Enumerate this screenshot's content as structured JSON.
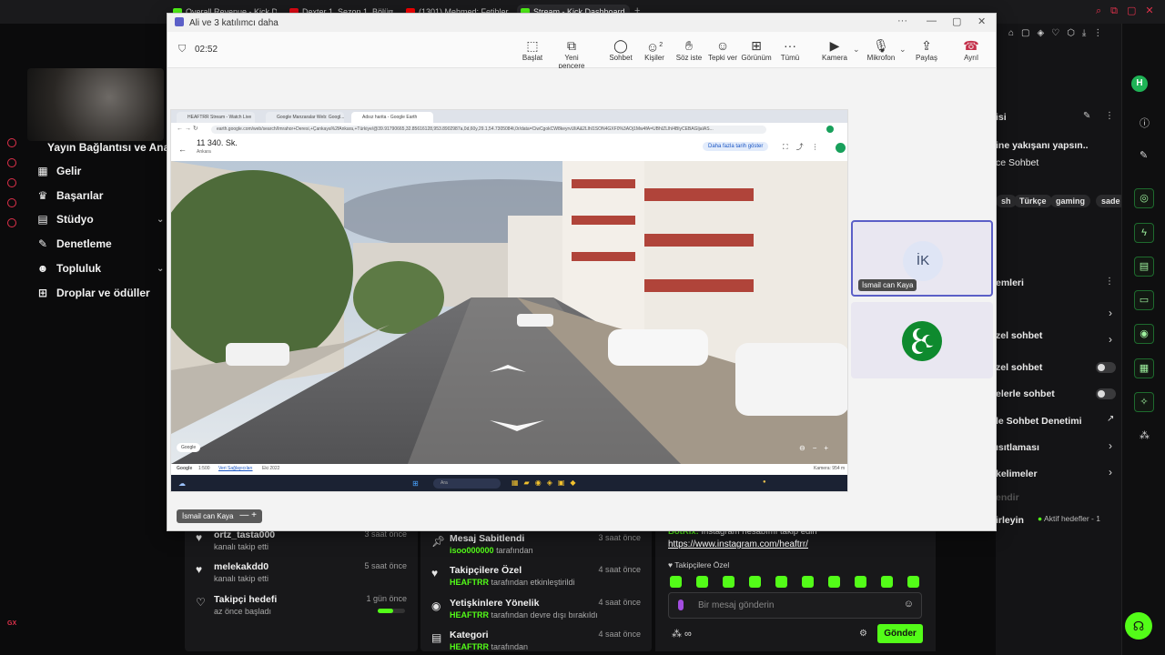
{
  "browser_tabs": [
    {
      "label": "Overall Revenue - Kick Da"
    },
    {
      "label": "Dexter 1. Sezon 1. Bölüm"
    },
    {
      "label": "(1301) Mehmed: Fetihler S"
    },
    {
      "label": "Stream - Kick Dashboard"
    }
  ],
  "sidebar": {
    "header": "Yayın Bağlantısı ve Anahta",
    "items": [
      {
        "label": "Gelir"
      },
      {
        "label": "Başarılar"
      },
      {
        "label": "Stüdyo"
      },
      {
        "label": "Denetleme"
      },
      {
        "label": "Topluluk"
      },
      {
        "label": "Droplar ve ödüller"
      }
    ]
  },
  "teams": {
    "window_title": "Ali ve 3 katılımcı daha",
    "timer": "02:52",
    "toolbar": [
      {
        "label": "Başlat"
      },
      {
        "label": "Yeni pencere"
      },
      {
        "label": "Sohbet"
      },
      {
        "label": "Kişiler",
        "count": "2"
      },
      {
        "label": "Söz iste"
      },
      {
        "label": "Tepki ver"
      },
      {
        "label": "Görünüm"
      },
      {
        "label": "Tümü"
      },
      {
        "label": "Kamera"
      },
      {
        "label": "Mikrofon"
      },
      {
        "label": "Paylaş"
      },
      {
        "label": "Ayrıl"
      }
    ],
    "presenter_tag": "İsmail can Kaya",
    "participants": [
      {
        "initials": "İK",
        "name": "İsmail can Kaya"
      },
      {
        "initials": "",
        "name": ""
      }
    ]
  },
  "shared_screen": {
    "tabs": [
      {
        "label": "HEAFTRR Stream - Watch Live"
      },
      {
        "label": "Google Manzaralar Web: Googl..."
      },
      {
        "label": "Adsız harita - Google Earth"
      }
    ],
    "url": "earth.google.com/web/search/Imrahor+Deresi,+Çankaya%2fAnkara,+Türkiye/@39.91790665,32.85616128,953.8902987a,0d,60y,29.1,54.7305084t,0r/data=CiwCgokCW8keyrvUliA&2LlhI1SON4GXF0%3AOj1Mw4fA=UBhIZLlhI4BlyCEBAGljaIAS...",
    "place_title": "11 340. Sk.",
    "place_sub": "Ankara",
    "history_button": "Daha fazla tarih göster",
    "google_badge": "Google",
    "status_left": "Google",
    "status_scale": "1:500",
    "status_link": "Veri Sağlayıcıları",
    "status_date": "Eki 2022",
    "status_right": "Kamera: 954 m",
    "search_placeholder": "Ara"
  },
  "right_panel": {
    "title_fragment": "isi",
    "desc": "ine yakışanı yapsın..",
    "category": "ce Sohbet",
    "tags": [
      "sh",
      "Türkçe",
      "gaming",
      "sade"
    ],
    "settings_title": "emleri",
    "rows": [
      {
        "label": "zel sohbet"
      },
      {
        "label": "zel sohbet"
      },
      {
        "label": "elerle sohbet"
      },
      {
        "label": "le Sohbet Denetimi"
      },
      {
        "label": "ısıtlaması"
      },
      {
        "label": "kelimeler"
      },
      {
        "label": "endir"
      },
      {
        "label": "irleyin"
      }
    ],
    "active_goals": "Aktif hedefler - 1",
    "avatar_letter": "H"
  },
  "followers_card": {
    "items": [
      {
        "title": "ortz_tasta000",
        "sub": "kanalı takip etti",
        "time": "3 saat önce"
      },
      {
        "title": "melekakdd0",
        "sub": "kanalı takip etti",
        "time": "5 saat önce"
      },
      {
        "title": "Takipçi hedefi",
        "sub": "az önce başladı",
        "time": "1 gün önce"
      }
    ]
  },
  "events_card": {
    "items": [
      {
        "title": "Mesaj Sabitlendi",
        "user": "isoo000000",
        "sub": "tarafından",
        "time": "3 saat önce"
      },
      {
        "title": "Takipçilere Özel",
        "user": "HEAFTRR",
        "sub": "tarafından etkinleştirildi",
        "time": "4 saat önce"
      },
      {
        "title": "Yetişkinlere Yönelik",
        "user": "HEAFTRR",
        "sub": "tarafından devre dışı bırakıldı",
        "time": "4 saat önce"
      },
      {
        "title": "Kategori",
        "user": "HEAFTRR",
        "sub": "tarafından",
        "time": "4 saat önce"
      }
    ]
  },
  "chat": {
    "bot_name": "BotRix:",
    "bot_message": "Instagram hesabımı takip edin",
    "link": "https://www.instagram.com/heaftrr/",
    "follower_only": "Takipçilere Özel",
    "input_placeholder": "Bir mesaj gönderin",
    "send_label": "Gönder"
  },
  "colors": {
    "kick_green": "#53fc18",
    "teams_purple": "#5b5fc7",
    "leave_red": "#c4314b"
  }
}
